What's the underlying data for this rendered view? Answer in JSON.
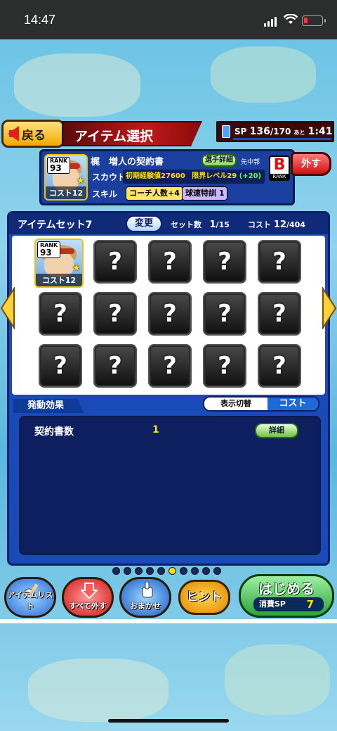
{
  "status_bar": {
    "time": "14:47"
  },
  "header": {
    "back_label": "戻る",
    "title": "アイテム選択"
  },
  "sp": {
    "label": "SP",
    "current": "136",
    "max": "/170",
    "suffix": "あと",
    "timer": "1:41"
  },
  "selected_item": {
    "name": "梶　増人の契約書",
    "rank_label": "RANK",
    "rank_value": "93",
    "cost_label": "コスト12",
    "detail_button": "選手詳細",
    "position": "先中郭",
    "grade": "B",
    "grade_label": "RANK",
    "scout_label": "スカウト",
    "scout_text": "初期経験値27600",
    "limit_text": "限界レベル29",
    "limit_bonus": "(+20)",
    "skill_label": "スキル",
    "skills": [
      "コーチ人数+4",
      "球速特訓 1"
    ],
    "remove_button": "外す"
  },
  "item_set": {
    "name": "アイテムセット7",
    "change_button": "変更",
    "count_label": "セット数",
    "count_value": "1",
    "count_max": "/15",
    "cost_label": "コスト",
    "cost_value": "12",
    "cost_max": "/404",
    "slot_placeholder": "?"
  },
  "effects": {
    "header": "発動効果",
    "toggle_label": "表示切替",
    "toggle_value": "コスト",
    "rows": [
      {
        "label": "契約書数",
        "value": "1",
        "button": "詳細"
      }
    ]
  },
  "pagination": {
    "pages": 10,
    "current": 6
  },
  "bottom": {
    "item_list": "アイテムリスト",
    "remove_all": "すべて外す",
    "auto": "おまかせ",
    "hint": "ヒント",
    "start": "はじめる",
    "sp_cost_label": "消費SP",
    "sp_cost_value": "7"
  },
  "colors": {
    "accent_red": "#c01818",
    "panel_blue": "#1a4ab8",
    "yellow": "#ffe000"
  }
}
